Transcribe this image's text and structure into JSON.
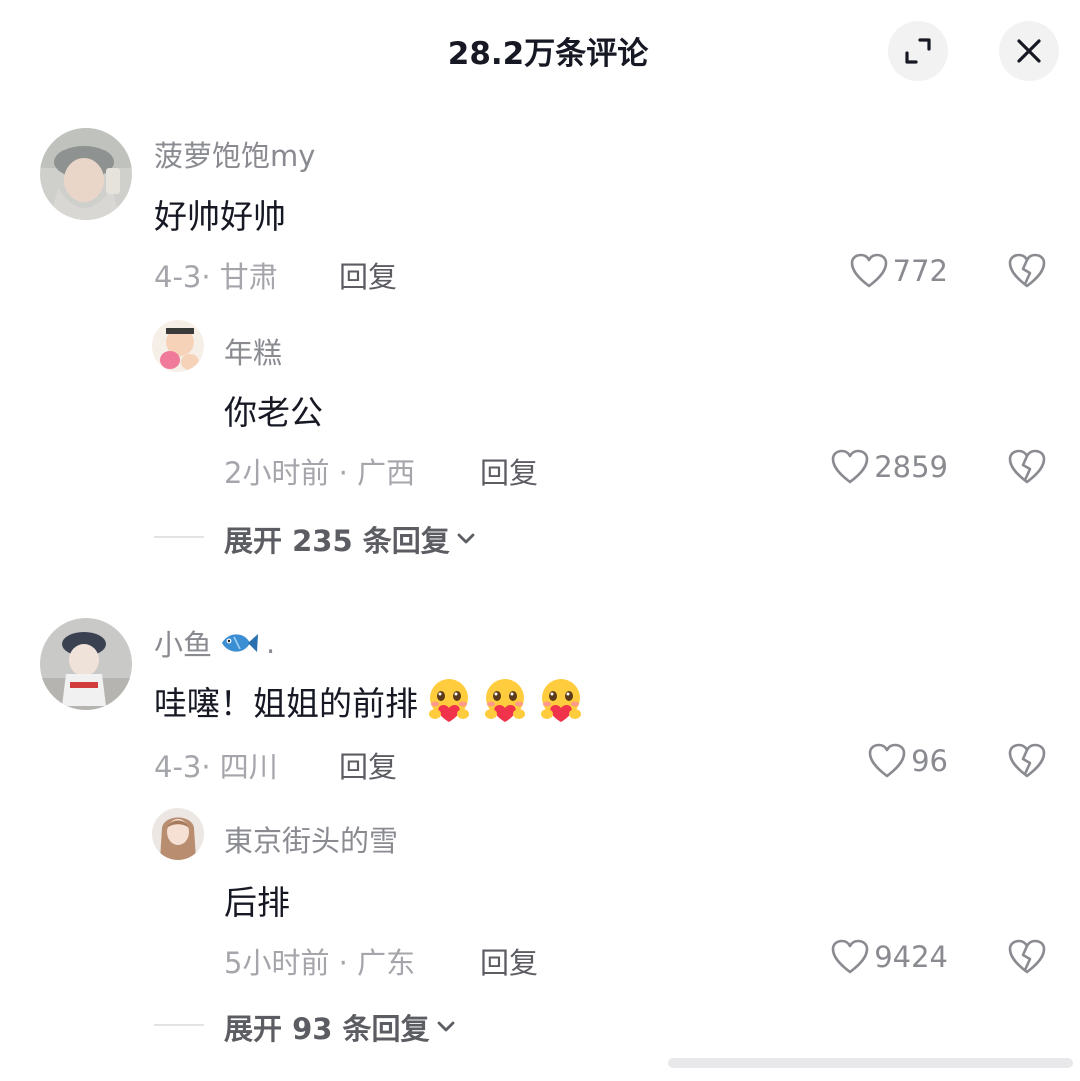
{
  "header": {
    "title": "28.2万条评论"
  },
  "comments": [
    {
      "user": "菠萝饱饱my",
      "text": "好帅好帅",
      "meta": "4-3· 甘肃",
      "reply_label": "回复",
      "likes": "772",
      "replies": [
        {
          "user": "年糕",
          "text": "你老公",
          "meta": "2小时前 · 广西",
          "reply_label": "回复",
          "likes": "2859"
        }
      ],
      "expand_label": "展开 235 条回复"
    },
    {
      "user": "小鱼",
      "user_suffix": ".",
      "text": "哇噻！姐姐的前排",
      "meta": "4-3· 四川",
      "reply_label": "回复",
      "likes": "96",
      "replies": [
        {
          "user": "東京街头的雪",
          "text": "后排",
          "meta": "5小时前 · 广东",
          "reply_label": "回复",
          "likes": "9424"
        }
      ],
      "expand_label": "展开 93 条回复"
    }
  ],
  "icons": {
    "header_left": "expand-icon",
    "header_right": "close-icon",
    "like": "heart-outline-icon",
    "dislike": "broken-heart-icon",
    "emoji": "blushing-heart-emoji-icon",
    "fish": "fish-emoji-icon"
  },
  "colors": {
    "text_primary": "#161823",
    "text_secondary": "#8a8b91",
    "header_button_bg": "#f2f2f3"
  }
}
